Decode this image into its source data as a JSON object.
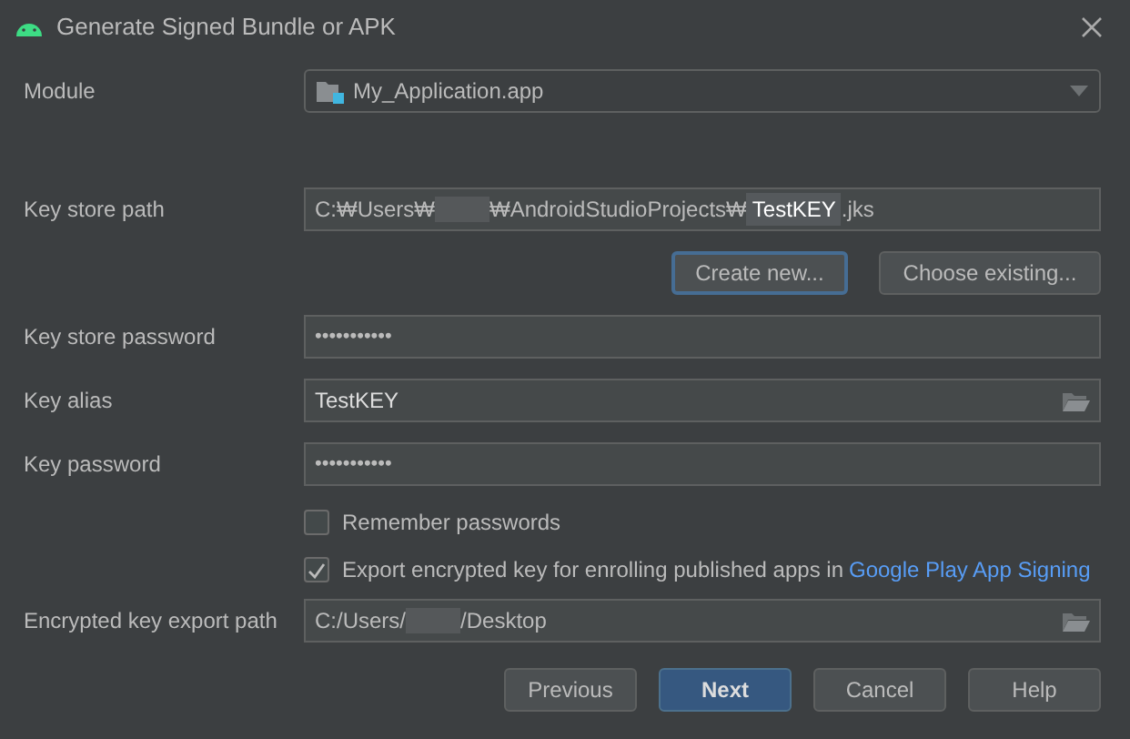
{
  "window": {
    "title": "Generate Signed Bundle or APK"
  },
  "module": {
    "label": "Module",
    "value": "My_Application.app"
  },
  "key_store_path": {
    "label": "Key store path",
    "segments": [
      {
        "kind": "text",
        "text": "C:₩Users₩"
      },
      {
        "kind": "redacted"
      },
      {
        "kind": "text",
        "text": "₩AndroidStudioProjects₩"
      },
      {
        "kind": "highlight",
        "text": "TestKEY"
      },
      {
        "kind": "text",
        "text": ".jks"
      }
    ]
  },
  "key_store_buttons": [
    {
      "label": "Create new...",
      "focused": true
    },
    {
      "label": "Choose existing...",
      "focused": false
    }
  ],
  "fields": [
    {
      "label": "Key store password",
      "kind": "password",
      "value": "•••••••••••"
    },
    {
      "label": "Key alias",
      "kind": "browse",
      "value": "TestKEY"
    },
    {
      "label": "Key password",
      "kind": "password",
      "value": "•••••••••••"
    }
  ],
  "checkboxes": [
    {
      "label": "Remember passwords",
      "checked": false
    },
    {
      "label": "Export encrypted key for enrolling published apps in",
      "checked": true,
      "link": "Google Play App Signing"
    }
  ],
  "export_path": {
    "label": "Encrypted key export path",
    "segments": [
      {
        "kind": "text",
        "text": "C:/Users/"
      },
      {
        "kind": "redacted"
      },
      {
        "kind": "text",
        "text": "/Desktop"
      }
    ]
  },
  "buttons": [
    {
      "label": "Previous",
      "primary": false
    },
    {
      "label": "Next",
      "primary": true
    },
    {
      "label": "Cancel",
      "primary": false
    },
    {
      "label": "Help",
      "primary": false
    }
  ]
}
